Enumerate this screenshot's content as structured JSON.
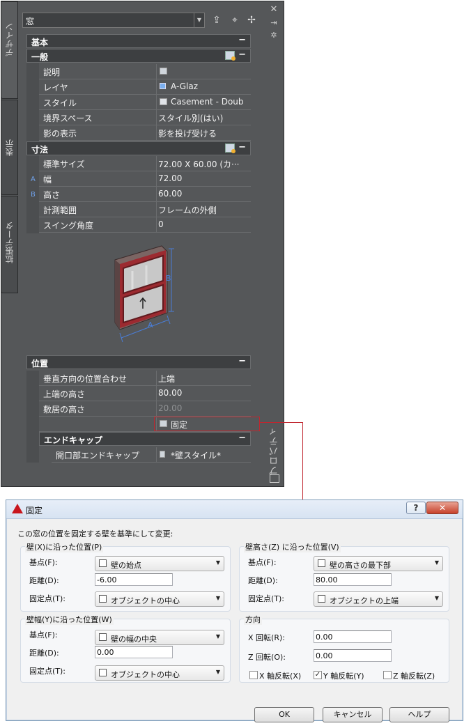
{
  "palette": {
    "object_type": "窓",
    "tabs": [
      "デザイン",
      "表示",
      "拡張データ"
    ],
    "side_title": "プロパティ",
    "sections": {
      "basic": "基本",
      "general": "一般",
      "dimensions": "寸法",
      "location": "位置",
      "endcaps": "エンドキャップ"
    },
    "collapse_glyph": "−",
    "general_rows": [
      {
        "label": "説明",
        "value": ""
      },
      {
        "label": "レイヤ",
        "value": "A-Glaz"
      },
      {
        "label": "スタイル",
        "value": "Casement - Doub"
      },
      {
        "label": "境界スペース",
        "value": "スタイル別(はい)"
      },
      {
        "label": "影の表示",
        "value": "影を投げ受ける"
      }
    ],
    "dimension_rows": [
      {
        "label": "標準サイズ",
        "value": "72.00 X   60.00 (カ···"
      },
      {
        "label": "幅",
        "value": "72.00",
        "marker": "A"
      },
      {
        "label": "高さ",
        "value": "60.00",
        "marker": "B"
      },
      {
        "label": "計測範囲",
        "value": "フレームの外側"
      },
      {
        "label": "スイング角度",
        "value": "0"
      }
    ],
    "preview_labels": {
      "a": "A",
      "b": "B"
    },
    "location_rows": [
      {
        "label": "垂直方向の位置合わせ",
        "value": "上端"
      },
      {
        "label": "上端の高さ",
        "value": "80.00"
      },
      {
        "label": "敷居の高さ",
        "value": "20.00"
      },
      {
        "label": "",
        "value": "固定"
      }
    ],
    "endcap_rows": [
      {
        "label": "開口部エンドキャップ",
        "value": "*壁スタイル*"
      }
    ]
  },
  "dialog": {
    "title": "固定",
    "help": "?",
    "close": "✕",
    "intro": "この窓の位置を固定する壁を基準にして変更:",
    "group_x": {
      "title": "壁(X)に沿った位置(P)",
      "base_label": "基点(F):",
      "base_value": "壁の始点",
      "dist_label": "距離(D):",
      "dist_value": "-6.00",
      "fix_label": "固定点(T):",
      "fix_value": "オブジェクトの中心"
    },
    "group_y": {
      "title": "壁幅(Y)に沿った位置(W)",
      "base_label": "基点(F):",
      "base_value": "壁の幅の中央",
      "dist_label": "距離(D):",
      "dist_value": "0.00",
      "fix_label": "固定点(T):",
      "fix_value": "オブジェクトの中心"
    },
    "group_z": {
      "title": "壁高さ(Z) に沿った位置(V)",
      "base_label": "基点(F):",
      "base_value": "壁の高さの最下部",
      "dist_label": "距離(D):",
      "dist_value": "80.00",
      "fix_label": "固定点(T):",
      "fix_value": "オブジェクトの上端"
    },
    "group_dir": {
      "title": "方向",
      "xrot_label": "X 回転(R):",
      "xrot_value": "0.00",
      "zrot_label": "Z 回転(O):",
      "zrot_value": "0.00",
      "flip_x": "X 軸反転(X)",
      "flip_y": "Y 軸反転(Y)",
      "flip_z": "Z 軸反転(Z)",
      "checked_mark": "✓"
    },
    "buttons": {
      "ok": "OK",
      "cancel": "キャンセル",
      "help": "ヘルプ"
    }
  },
  "colors": {
    "highlight": "#c0262f",
    "palette_bg": "#555759",
    "marker_blue": "#6fa0e8"
  }
}
